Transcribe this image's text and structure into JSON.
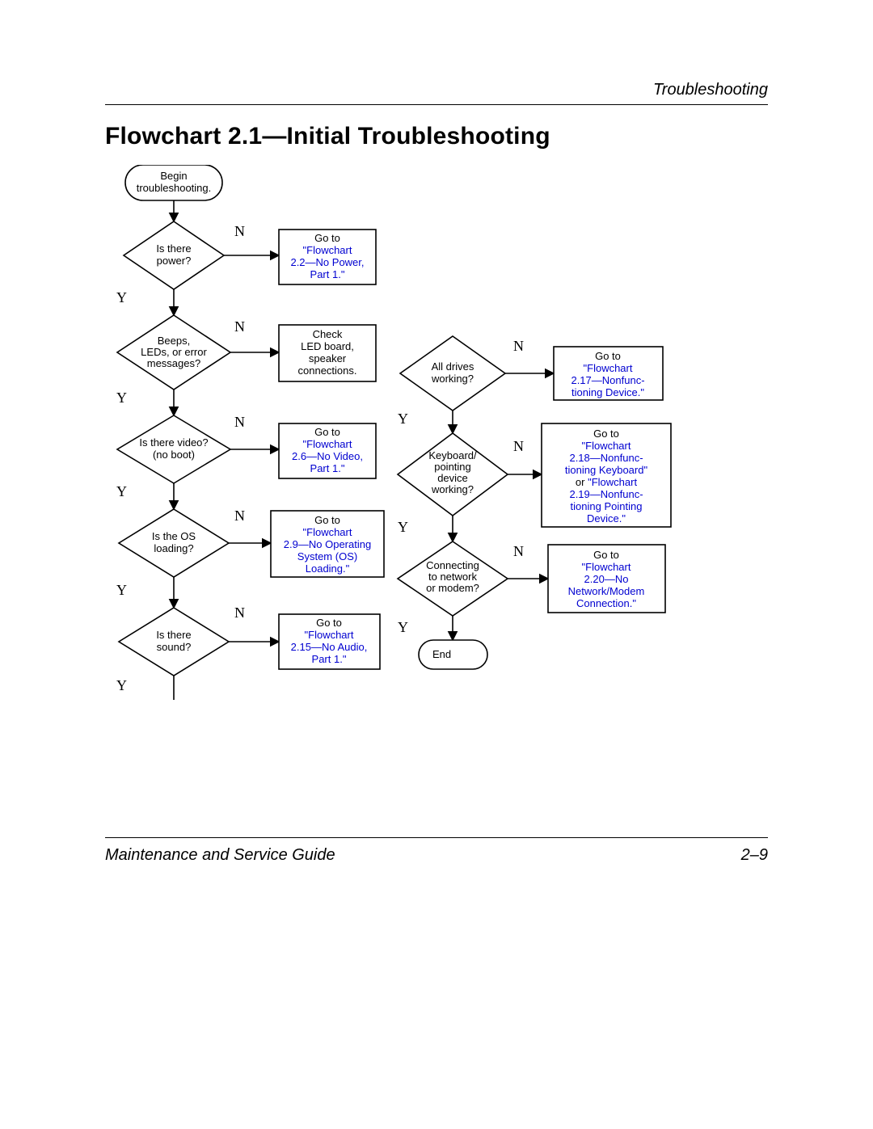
{
  "header": {
    "section": "Troubleshooting"
  },
  "title": "Flowchart 2.1—Initial Troubleshooting",
  "footer": {
    "left": "Maintenance and Service Guide",
    "right": "2–9"
  },
  "terminals": {
    "begin": {
      "l1": "Begin",
      "l2": "troubleshooting."
    },
    "end": {
      "l1": "End"
    }
  },
  "decisions": {
    "power": {
      "l1": "Is there",
      "l2": "power?"
    },
    "beeps": {
      "l1": "Beeps,",
      "l2": "LEDs, or error",
      "l3": "messages?"
    },
    "video": {
      "l1": "Is there video?",
      "l2": "(no boot)"
    },
    "os": {
      "l1": "Is the OS",
      "l2": "loading?"
    },
    "sound": {
      "l1": "Is there",
      "l2": "sound?"
    },
    "drives": {
      "l1": "All drives",
      "l2": "working?"
    },
    "kbd": {
      "l1": "Keyboard/",
      "l2": "pointing",
      "l3": "device",
      "l4": "working?"
    },
    "net": {
      "l1": "Connecting",
      "l2": "to network",
      "l3": "or modem?"
    }
  },
  "actions": {
    "nopower": {
      "pre": "Go to",
      "link": "\"Flowchart 2.2—No Power, Part 1.\"",
      "link_lines": [
        "\"Flowchart",
        "2.2—No Power,",
        "Part 1.\""
      ]
    },
    "checkled": {
      "lines": [
        "Check",
        "LED board,",
        "speaker",
        "connections."
      ]
    },
    "novideo": {
      "pre": "Go to",
      "link_lines": [
        "\"Flowchart",
        "2.6—No Video,",
        "Part 1.\""
      ]
    },
    "noos": {
      "pre": "Go to",
      "link_lines": [
        "\"Flowchart",
        "2.9—No Operating",
        "System (OS)",
        "Loading.\""
      ]
    },
    "noaudio": {
      "pre": "Go to",
      "link_lines": [
        "\"Flowchart",
        "2.15—No Audio,",
        "Part 1.\""
      ]
    },
    "nfdev": {
      "pre": "Go to",
      "link_lines": [
        "\"Flowchart",
        "2.17—Nonfunc-",
        "tioning Device.\""
      ]
    },
    "nfkbd": {
      "pre": "Go to",
      "link1": [
        "\"Flowchart",
        "2.18—Nonfunc-",
        "tioning Keyboard\""
      ],
      "mid": "or",
      "link2": [
        "\"Flowchart",
        "2.19—Nonfunc-",
        "tioning Pointing",
        "Device.\""
      ]
    },
    "nomodem": {
      "pre": "Go to",
      "link_lines": [
        "\"Flowchart",
        "2.20—No",
        "Network/Modem",
        "Connection.\""
      ]
    }
  },
  "labels": {
    "yes": "Y",
    "no": "N"
  },
  "chart_data": {
    "type": "flowchart",
    "title": "Flowchart 2.1—Initial Troubleshooting",
    "nodes": [
      {
        "id": "begin",
        "kind": "terminal",
        "label": "Begin troubleshooting."
      },
      {
        "id": "power",
        "kind": "decision",
        "label": "Is there power?"
      },
      {
        "id": "nopower",
        "kind": "process",
        "label": "Go to \"Flowchart 2.2—No Power, Part 1.\""
      },
      {
        "id": "beeps",
        "kind": "decision",
        "label": "Beeps, LEDs, or error messages?"
      },
      {
        "id": "checkled",
        "kind": "process",
        "label": "Check LED board, speaker connections."
      },
      {
        "id": "video",
        "kind": "decision",
        "label": "Is there video? (no boot)"
      },
      {
        "id": "novideo",
        "kind": "process",
        "label": "Go to \"Flowchart 2.6—No Video, Part 1.\""
      },
      {
        "id": "os",
        "kind": "decision",
        "label": "Is the OS loading?"
      },
      {
        "id": "noos",
        "kind": "process",
        "label": "Go to \"Flowchart 2.9—No Operating System (OS) Loading.\""
      },
      {
        "id": "sound",
        "kind": "decision",
        "label": "Is there sound?"
      },
      {
        "id": "noaudio",
        "kind": "process",
        "label": "Go to \"Flowchart 2.15—No Audio, Part 1.\""
      },
      {
        "id": "drives",
        "kind": "decision",
        "label": "All drives working?"
      },
      {
        "id": "nfdev",
        "kind": "process",
        "label": "Go to \"Flowchart 2.17—Nonfunctioning Device.\""
      },
      {
        "id": "kbd",
        "kind": "decision",
        "label": "Keyboard/pointing device working?"
      },
      {
        "id": "nfkbd",
        "kind": "process",
        "label": "Go to \"Flowchart 2.18—Nonfunctioning Keyboard\" or \"Flowchart 2.19—Nonfunctioning Pointing Device.\""
      },
      {
        "id": "net",
        "kind": "decision",
        "label": "Connecting to network or modem?"
      },
      {
        "id": "nomodem",
        "kind": "process",
        "label": "Go to \"Flowchart 2.20—No Network/Modem Connection.\""
      },
      {
        "id": "end",
        "kind": "terminal",
        "label": "End"
      }
    ],
    "edges": [
      {
        "from": "begin",
        "to": "power"
      },
      {
        "from": "power",
        "to": "nopower",
        "label": "N"
      },
      {
        "from": "power",
        "to": "beeps",
        "label": "Y"
      },
      {
        "from": "beeps",
        "to": "checkled",
        "label": "N"
      },
      {
        "from": "beeps",
        "to": "video",
        "label": "Y"
      },
      {
        "from": "video",
        "to": "novideo",
        "label": "N"
      },
      {
        "from": "video",
        "to": "os",
        "label": "Y"
      },
      {
        "from": "os",
        "to": "noos",
        "label": "N"
      },
      {
        "from": "os",
        "to": "sound",
        "label": "Y"
      },
      {
        "from": "sound",
        "to": "noaudio",
        "label": "N"
      },
      {
        "from": "sound",
        "to": "drives",
        "label": "Y"
      },
      {
        "from": "drives",
        "to": "nfdev",
        "label": "N"
      },
      {
        "from": "drives",
        "to": "kbd",
        "label": "Y"
      },
      {
        "from": "kbd",
        "to": "nfkbd",
        "label": "N"
      },
      {
        "from": "kbd",
        "to": "net",
        "label": "Y"
      },
      {
        "from": "net",
        "to": "nomodem",
        "label": "N"
      },
      {
        "from": "net",
        "to": "end",
        "label": "Y"
      }
    ]
  }
}
